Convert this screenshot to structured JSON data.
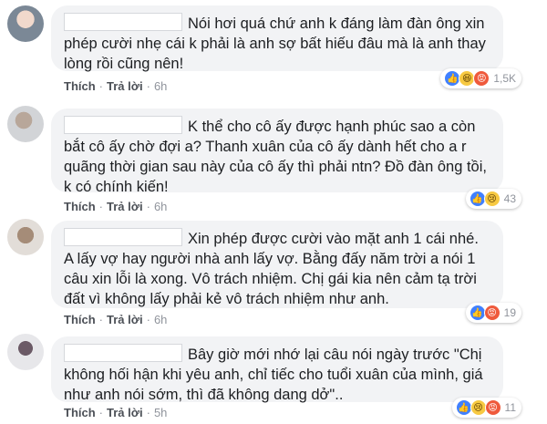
{
  "actions": {
    "like": "Thích",
    "reply": "Trả lời",
    "separator": "·"
  },
  "comments": [
    {
      "text": "Nói hơi quá chứ anh k đáng làm đàn ông xin phép cười nhẹ cái k phải là anh sợ bất hiếu đâu mà là anh thay lòng rồi cũng nên!",
      "time": "6h",
      "reactions": [
        "like-icon",
        "haha-icon",
        "angry-icon"
      ],
      "reaction_count": "1,5K"
    },
    {
      "text": "K thể cho cô ấy được hạnh phúc sao a còn bắt cô ấy chờ đợi a? Thanh xuân của cô ấy dành hết cho a r quãng thời gian sau này của cô ấy thì phải ntn? Đồ đàn ông tồi, k có chính kiến!",
      "time": "6h",
      "reactions": [
        "like-icon",
        "sad-icon"
      ],
      "reaction_count": "43"
    },
    {
      "text": "Xin phép được cười vào mặt anh 1 cái nhé. A lấy vợ hay người nhà anh lấy vợ. Bằng đấy năm trời a nói 1 câu xin lỗi là xong. Vô trách nhiệm. Chị gái kia nên cảm tạ trời đất vì không lấy phải kẻ vô trách nhiệm như anh.",
      "time": "6h",
      "reactions": [
        "like-icon",
        "angry-icon"
      ],
      "reaction_count": "19"
    },
    {
      "text": "Bây giờ mới nhớ lại câu nói ngày trước \"Chị không hối hận khi yêu anh, chỉ tiếc cho tuổi xuân của mình, giá như anh nói sớm, thì đã không dang dở\"..",
      "time": "5h",
      "reactions": [
        "like-icon",
        "sad-icon",
        "angry-icon"
      ],
      "reaction_count": "11"
    }
  ]
}
